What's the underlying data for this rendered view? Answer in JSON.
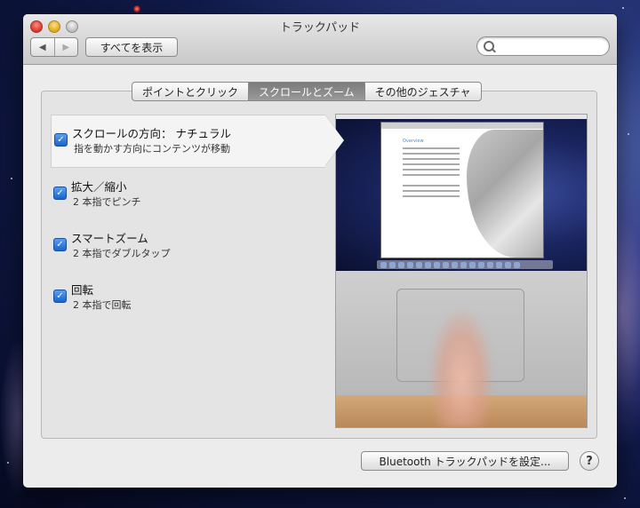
{
  "window": {
    "title": "トラックパッド"
  },
  "toolbar": {
    "back_glyph": "◀",
    "forward_glyph": "▶",
    "show_all_label": "すべてを表示",
    "search_placeholder": "",
    "search_icon": "search-icon"
  },
  "tabs": [
    {
      "label": "ポイントとクリック",
      "active": false
    },
    {
      "label": "スクロールとズーム",
      "active": true
    },
    {
      "label": "その他のジェスチャ",
      "active": false
    }
  ],
  "options": [
    {
      "title": "スクロールの方向： ナチュラル",
      "subtitle": "指を動かす方向にコンテンツが移動",
      "checked": true,
      "selected": true
    },
    {
      "title": "拡大／縮小",
      "subtitle": "2 本指でピンチ",
      "checked": true,
      "selected": false
    },
    {
      "title": "スマートズーム",
      "subtitle": "2 本指でダブルタップ",
      "checked": true,
      "selected": false
    },
    {
      "title": "回転",
      "subtitle": "2 本指で回転",
      "checked": true,
      "selected": false
    }
  ],
  "checkmark_glyph": "✓",
  "preview": {
    "heading": "Overview"
  },
  "footer": {
    "bluetooth_label": "Bluetooth トラックパッドを設定...",
    "help_label": "?"
  },
  "colors": {
    "accent": "#1b63c9",
    "active_tab": "#8a8a8a"
  }
}
